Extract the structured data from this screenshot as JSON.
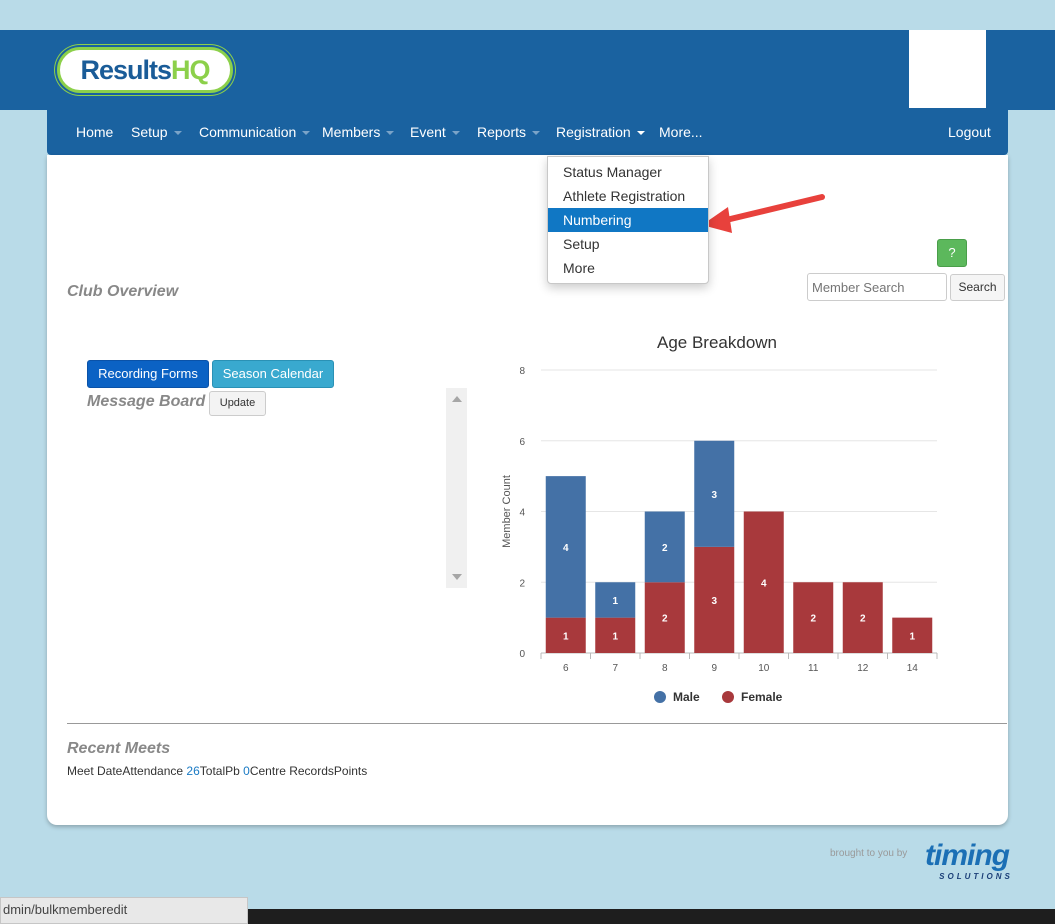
{
  "brand": {
    "logo_part1": "Results",
    "logo_part2": "HQ"
  },
  "nav": {
    "items": [
      {
        "label": "Home",
        "dropdown": false
      },
      {
        "label": "Setup",
        "dropdown": true
      },
      {
        "label": "Communication",
        "dropdown": true
      },
      {
        "label": "Members",
        "dropdown": true
      },
      {
        "label": "Event",
        "dropdown": true
      },
      {
        "label": "Reports",
        "dropdown": true
      },
      {
        "label": "Registration",
        "dropdown": true
      },
      {
        "label": "More...",
        "dropdown": false
      }
    ],
    "logout": "Logout"
  },
  "registration_menu": {
    "items": [
      "Status Manager",
      "Athlete Registration",
      "Numbering",
      "Setup",
      "More"
    ],
    "active": "Numbering"
  },
  "help": {
    "label": "?"
  },
  "search": {
    "placeholder": "Member Search",
    "button": "Search"
  },
  "club_overview": {
    "title": "Club Overview"
  },
  "buttons": {
    "recording_forms": "Recording Forms",
    "season_calendar": "Season Calendar",
    "update": "Update"
  },
  "message_board": {
    "title": "Message Board"
  },
  "chart_data": {
    "type": "bar",
    "stacked": true,
    "title": "Age Breakdown",
    "xlabel": "",
    "ylabel": "Member Count",
    "categories": [
      "6",
      "7",
      "8",
      "9",
      "10",
      "11",
      "12",
      "14"
    ],
    "series": [
      {
        "name": "Male",
        "color": "#4471a6",
        "values": [
          4,
          1,
          2,
          3,
          0,
          0,
          0,
          0
        ]
      },
      {
        "name": "Female",
        "color": "#a8393c",
        "values": [
          1,
          1,
          2,
          3,
          4,
          2,
          2,
          1
        ]
      }
    ],
    "ylim": [
      0,
      8
    ],
    "yticks": [
      0,
      2,
      4,
      6,
      8
    ],
    "grid": true,
    "legend_position": "bottom"
  },
  "recent_meets": {
    "title": "Recent Meets",
    "col_meet_date": "Meet Date",
    "col_attendance": "Attendance",
    "attendance_value": "26",
    "col_total_pb": "TotalPb",
    "total_pb_value": "0",
    "col_centre_records": "Centre Records",
    "col_points": "Points"
  },
  "footer": {
    "brought_by": "brought to you by",
    "timing_name": "timing",
    "timing_sub": "SOLUTIONS"
  },
  "status_bar": {
    "url": "dmin/bulkmemberedit"
  },
  "colors": {
    "nav_blue": "#1a62a0",
    "menu_active": "#1077c4",
    "male": "#4471a6",
    "female": "#a8393c",
    "page_bg": "#b9dbe8"
  }
}
